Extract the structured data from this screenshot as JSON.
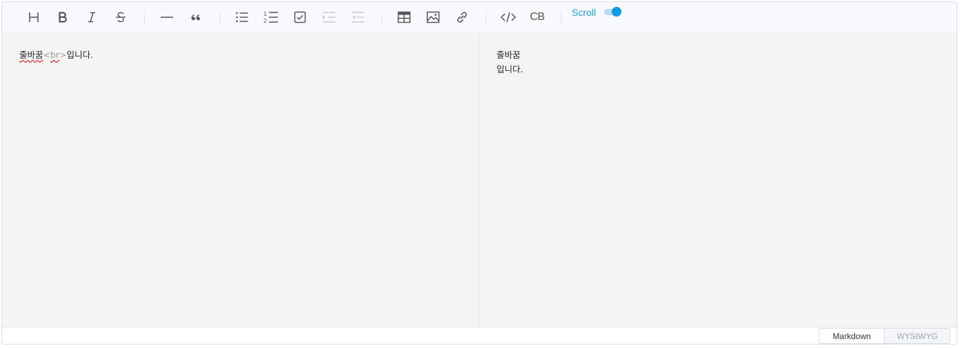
{
  "toolbar": {
    "buttons": [
      {
        "name": "heading",
        "icon": "heading-icon",
        "enabled": true
      },
      {
        "name": "bold",
        "icon": "bold-icon",
        "enabled": true
      },
      {
        "name": "italic",
        "icon": "italic-icon",
        "enabled": true
      },
      {
        "name": "strike",
        "icon": "strike-icon",
        "enabled": true
      },
      {
        "name": "hr",
        "icon": "horizontal-rule-icon",
        "enabled": true
      },
      {
        "name": "quote",
        "icon": "quote-icon",
        "enabled": true
      },
      {
        "name": "bullet-list",
        "icon": "bullet-list-icon",
        "enabled": true
      },
      {
        "name": "ordered-list",
        "icon": "ordered-list-icon",
        "enabled": true
      },
      {
        "name": "task-list",
        "icon": "task-list-icon",
        "enabled": true
      },
      {
        "name": "indent",
        "icon": "indent-icon",
        "enabled": false
      },
      {
        "name": "outdent",
        "icon": "outdent-icon",
        "enabled": false
      },
      {
        "name": "table",
        "icon": "table-icon",
        "enabled": true
      },
      {
        "name": "image",
        "icon": "image-icon",
        "enabled": true
      },
      {
        "name": "link",
        "icon": "link-icon",
        "enabled": true
      },
      {
        "name": "code",
        "icon": "code-icon",
        "enabled": true
      },
      {
        "name": "codeblock",
        "icon": "codeblock-icon",
        "enabled": true
      }
    ],
    "codeblock_label": "CB",
    "scroll_label": "Scroll",
    "scroll_sync_on": true,
    "accent_color": "#0f9be6"
  },
  "markdown": {
    "word1": "줄바꿈",
    "tag_open": "<",
    "tag_name": "br",
    "tag_close": ">",
    "word2": "입니다."
  },
  "preview": {
    "line1": "줄바꿈",
    "line2": "입니다."
  },
  "footer": {
    "markdown_tab": "Markdown",
    "wysiwyg_tab": "WYSIWYG",
    "active": "Markdown"
  }
}
